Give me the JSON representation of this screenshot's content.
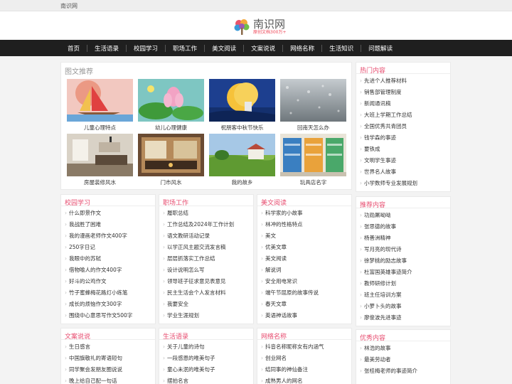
{
  "topbar": {
    "site": "南识网"
  },
  "logo": {
    "title": "南识网",
    "subtitle": "原创文档300万+"
  },
  "nav": [
    "首页",
    "生活语录",
    "校园学习",
    "职场工作",
    "美文阅读",
    "文案说说",
    "网络名称",
    "生活知识",
    "问题解读"
  ],
  "pictures": {
    "title": "图文推荐",
    "items": [
      {
        "caption": "儿童心理特点",
        "icon": "sailboat-drawing"
      },
      {
        "caption": "幼儿心理健康",
        "icon": "lotus-drawing"
      },
      {
        "caption": "祝朋客中秋节快乐",
        "icon": "moon-drawing"
      },
      {
        "caption": "回南天怎么办",
        "icon": "rain-window"
      },
      {
        "caption": "房屋装修风水",
        "icon": "room-interior"
      },
      {
        "caption": "门市风水",
        "icon": "shop-front"
      },
      {
        "caption": "我的故乡",
        "icon": "countryside"
      },
      {
        "caption": "玩具店名字",
        "icon": "toy-shop"
      }
    ]
  },
  "hot": {
    "title": "热门内容",
    "items": [
      "先进个人推荐材料",
      "销售部管理制度",
      "新闻通讯稿",
      "大班上学期工作总结",
      "全国优秀共青团员",
      "钱学森的事迹",
      "要铁成",
      "文明学生事迹",
      "世界名人故事",
      "小学数师专业发展规划"
    ]
  },
  "recommend": {
    "title": "推荐内容",
    "items": [
      "功勋屠呦呦",
      "张思德的故事",
      "杨善洲精神",
      "写月亮的现代诗",
      "徐梦桃的励志故事",
      "杜富国英雄事迹简介",
      "教师研修计划",
      "班主任培训方案",
      "小萝卜头的故事",
      "廖俊波先进事迹"
    ]
  },
  "excellent": {
    "title": "优秀内容",
    "items": [
      "林浩的故事",
      "最美劳动者",
      "张桂梅老师的事迹简介"
    ]
  },
  "campus": {
    "title": "校园学习",
    "items": [
      "什么即景作文",
      "我战胜了困难",
      "我的漫画老师作文400字",
      "250字日记",
      "我眼中的苏轼",
      "借物喻人的作文400字",
      "好斗的公鸡作文",
      "竹子蜜蜂梅花路灯小练笔",
      "成长的烦恼作文300字",
      "围绕中心意思写作文500字"
    ]
  },
  "work": {
    "title": "职场工作",
    "items": [
      "履职总结",
      "工作总结及2024年工作计划",
      "语文教研活动记录",
      "以学正风主题交流发言稿",
      "层层抓落实工作总结",
      "设计说明怎么写",
      "领导班子征求意见表意见",
      "民主生活会个人发言材料",
      "我要安全",
      "学业生涯规划"
    ]
  },
  "prose": {
    "title": "美文阅读",
    "items": [
      "科学家的小故事",
      "林冲的性格特点",
      "美文",
      "优美文章",
      "美文阅读",
      "解说词",
      "安全用电常识",
      "端午节屈原的故事传说",
      "春天文章",
      "英语神话故事"
    ]
  },
  "copywriting": {
    "title": "文案说说",
    "items": [
      "生日感言",
      "中国旗敬礼的寄语短句",
      "同学聚会发朋友圈说说",
      "晚上给自己配一句话"
    ]
  },
  "life": {
    "title": "生活语录",
    "items": [
      "关于儿童的诗句",
      "一段感恩的唯美句子",
      "童心未泯的唯美句子",
      "摆拍名言"
    ]
  },
  "netname": {
    "title": "网络名称",
    "items": [
      "抖音名称昵称女有内涵气",
      "创业网名",
      "结同事的神仙备注",
      "成熟男人的网名"
    ]
  }
}
